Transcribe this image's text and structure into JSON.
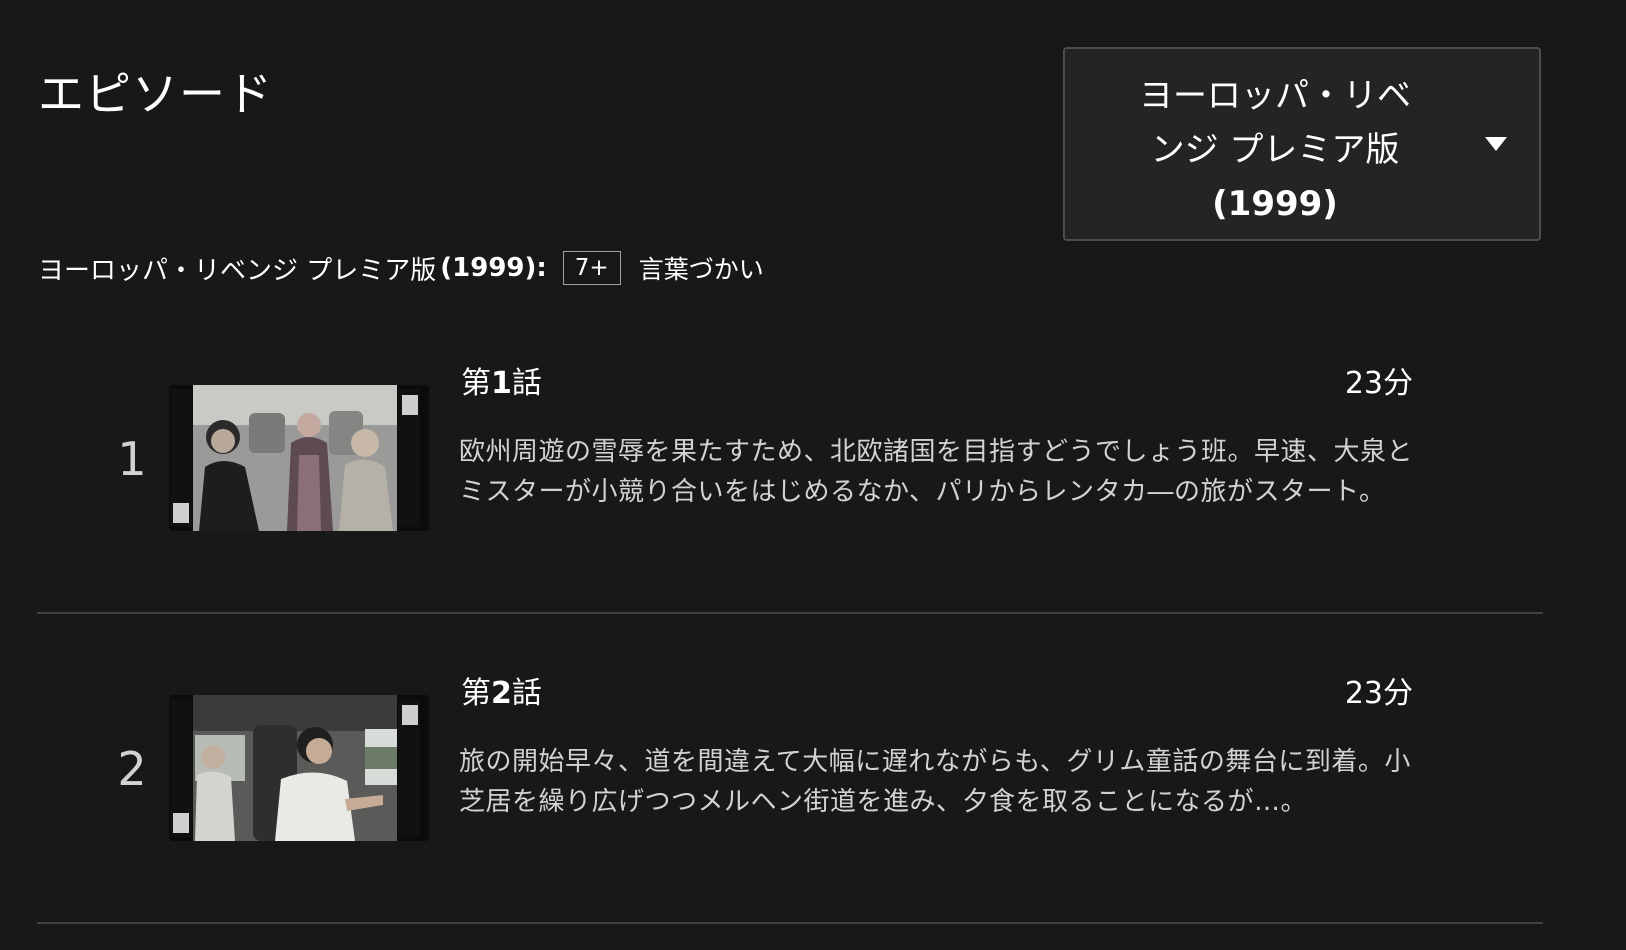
{
  "header": {
    "title": "エピソード"
  },
  "season_selector": {
    "label_line1": "ヨーロッパ・リベ",
    "label_line2": "ンジ プレミア版",
    "label_line3": "(1999)"
  },
  "rating": {
    "series_name": "ヨーロッパ・リベンジ プレミア版",
    "series_year": "(1999):",
    "badge": "7+",
    "descriptor": "言葉づかい"
  },
  "episodes": [
    {
      "number": "1",
      "title_prefix": "第",
      "title_num": "1",
      "title_suffix": "話",
      "duration": "23分",
      "description": "欧州周遊の雪辱を果たすため、北欧諸国を目指すどうでしょう班。早速、大泉とミスターが小競り合いをはじめるなか、パリからレンタカ―の旅がスタート。"
    },
    {
      "number": "2",
      "title_prefix": "第",
      "title_num": "2",
      "title_suffix": "話",
      "duration": "23分",
      "description": "旅の開始早々、道を間違えて大幅に遅れながらも、グリム童話の舞台に到着。小芝居を繰り広げつつメルヘン街道を進み、夕食を取ることになるが…。"
    }
  ],
  "colors": {
    "background": "#181818",
    "text": "#ffffff",
    "muted_text": "#d2d2d2",
    "divider": "#404040",
    "select_border": "#4d4d4d",
    "select_bg": "#242424"
  }
}
